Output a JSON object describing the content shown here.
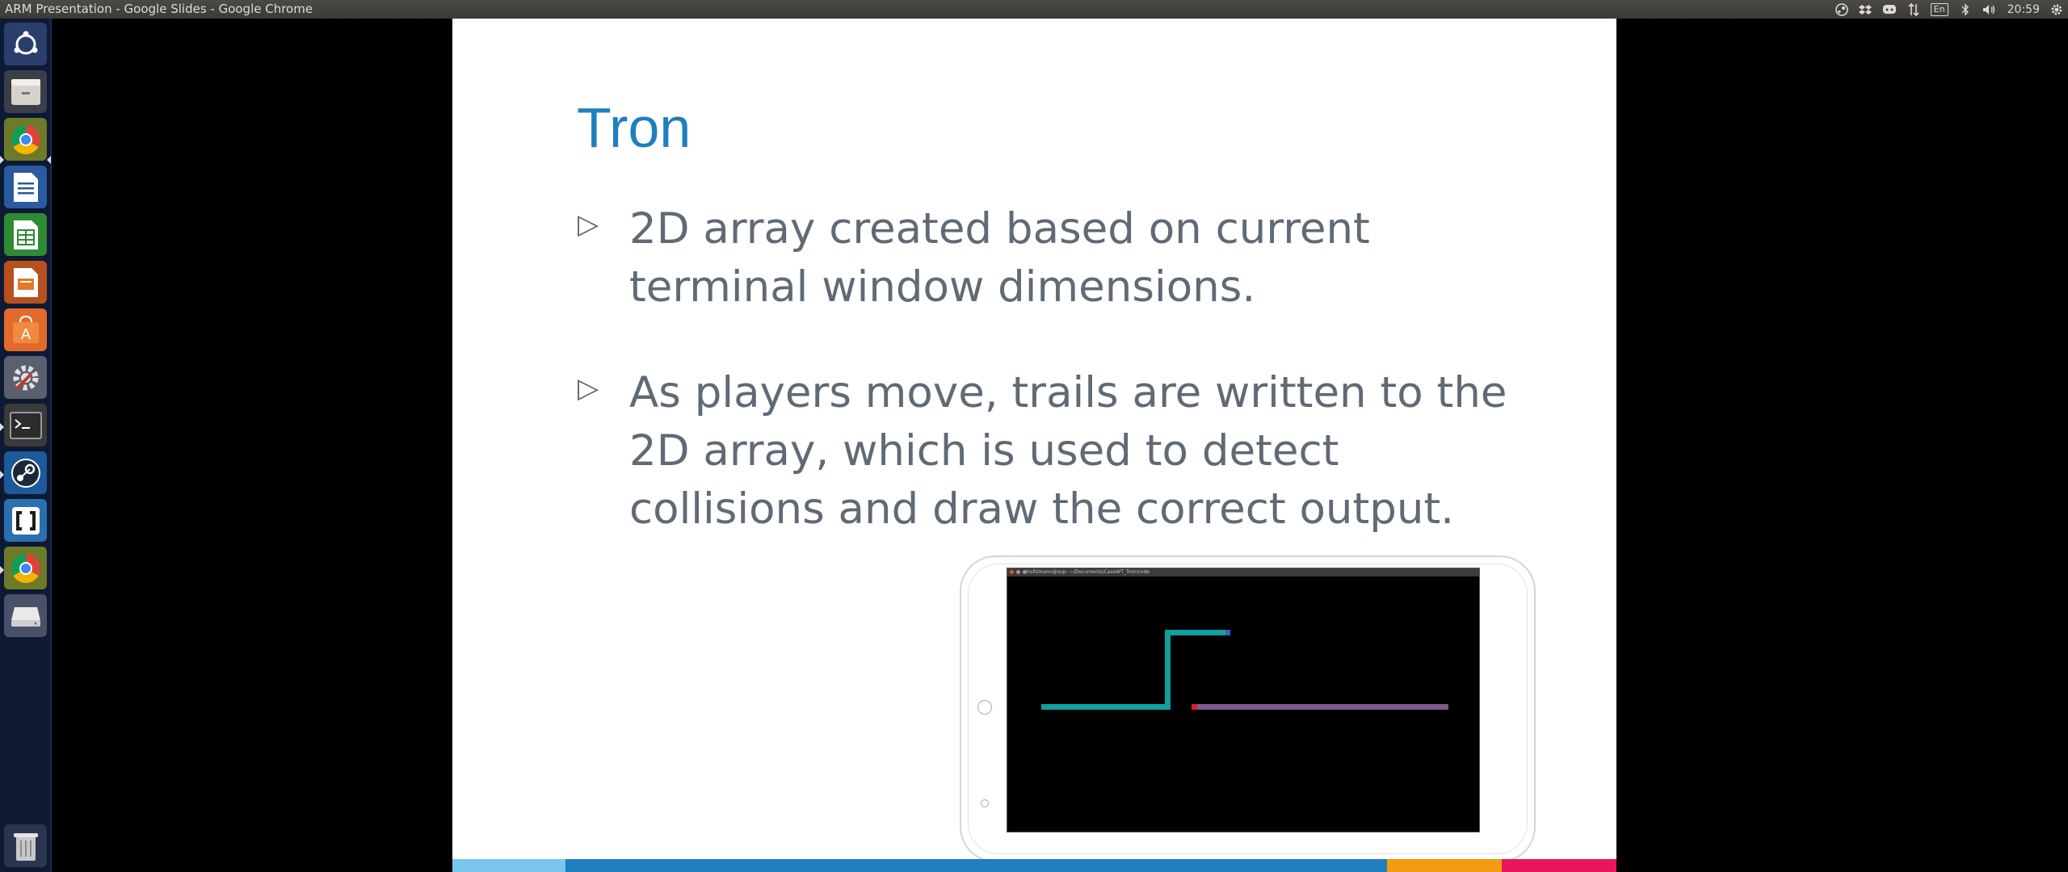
{
  "window": {
    "title": "ARM Presentation - Google Slides - Google Chrome"
  },
  "tray": {
    "icons": [
      "steam-tray-icon",
      "dropbox-icon",
      "discord-icon",
      "network-arrows-icon",
      "keyboard-layout-icon",
      "bluetooth-icon",
      "volume-icon",
      "gear-icon"
    ],
    "keyboard_layout": "En",
    "clock": "20:59"
  },
  "launcher": {
    "items": [
      "ubuntu-dash",
      "files",
      "chrome",
      "libreoffice-writer",
      "libreoffice-calc",
      "libreoffice-impress",
      "software-center",
      "system-settings",
      "terminal",
      "steam",
      "app-bracket",
      "chrome-2",
      "drive",
      "trash"
    ]
  },
  "slide": {
    "title": "Tron",
    "bullets": [
      "2D array created based on current terminal window dimensions.",
      "As players move, trails are written to the 2D array, which is used to detect collisions and draw the correct output."
    ],
    "bullet_symbol": "▷",
    "bar_colors": [
      "#7ac6ee",
      "#1f7fbf",
      "#f39c12",
      "#e8175d"
    ]
  },
  "terminal": {
    "title": "holtzmann@sup: ~/Documents/CaseWT_Tron/code"
  },
  "colors": {
    "player1": "#129e9e",
    "player2": "#7c5b8c",
    "player1_head": "#3b5fc0",
    "player2_head": "#d2202c"
  }
}
